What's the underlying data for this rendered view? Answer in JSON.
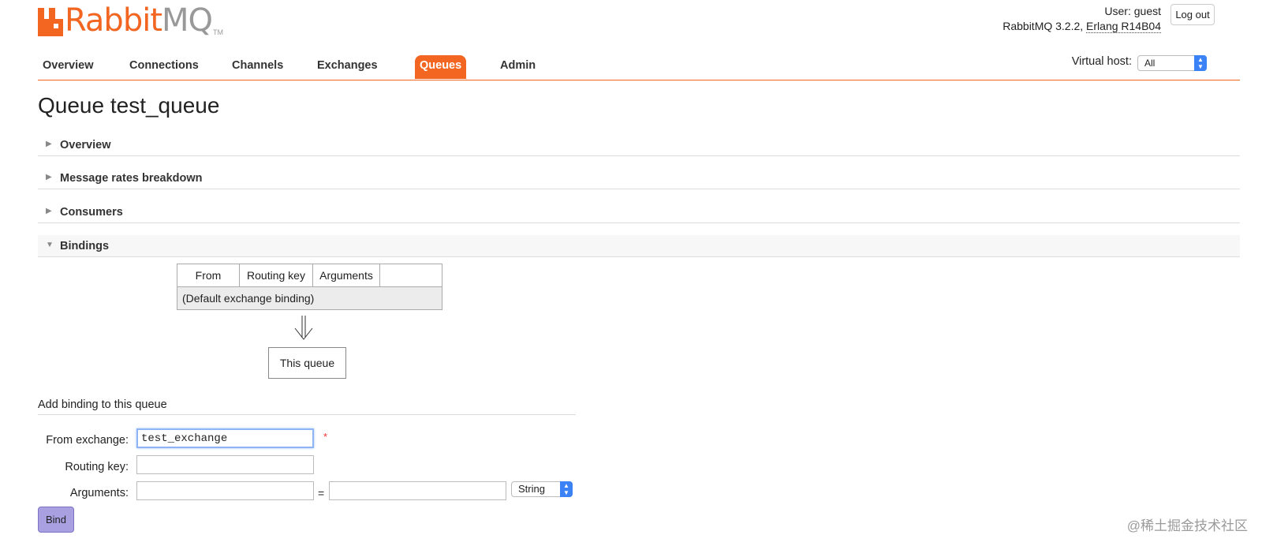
{
  "logo": {
    "prefix": "Rabbit",
    "suffix": "MQ",
    "tm": "TM"
  },
  "header": {
    "user_label": "User:",
    "user_name": "guest",
    "version": "RabbitMQ 3.2.2,",
    "erlang": "Erlang R14B04",
    "logout": "Log out"
  },
  "nav": {
    "tabs": [
      "Overview",
      "Connections",
      "Channels",
      "Exchanges",
      "Queues",
      "Admin"
    ],
    "active": "Queues"
  },
  "vhost": {
    "label": "Virtual host:",
    "selected": "All"
  },
  "page": {
    "title": "Queue test_queue"
  },
  "sections": [
    {
      "label": "Overview",
      "open": false
    },
    {
      "label": "Message rates breakdown",
      "open": false
    },
    {
      "label": "Consumers",
      "open": false
    },
    {
      "label": "Bindings",
      "open": true
    }
  ],
  "bindings": {
    "columns": [
      "From",
      "Routing key",
      "Arguments",
      ""
    ],
    "rows": [
      "(Default exchange binding)"
    ],
    "arrow": "⇓",
    "this_queue": "This queue"
  },
  "add_binding": {
    "title": "Add binding to this queue",
    "from_exchange_label": "From exchange:",
    "from_exchange_value": "test_exchange",
    "required_mark": "*",
    "routing_key_label": "Routing key:",
    "routing_key_value": "",
    "arguments_label": "Arguments:",
    "arguments_key": "",
    "equals": "=",
    "arguments_value": "",
    "type_selected": "String",
    "bind_button": "Bind"
  },
  "watermark": "@稀土掘金技术社区",
  "colors": {
    "brand": "#f26622",
    "select_accent": "#3b82f6",
    "bind_button": "#a8a0e0"
  }
}
